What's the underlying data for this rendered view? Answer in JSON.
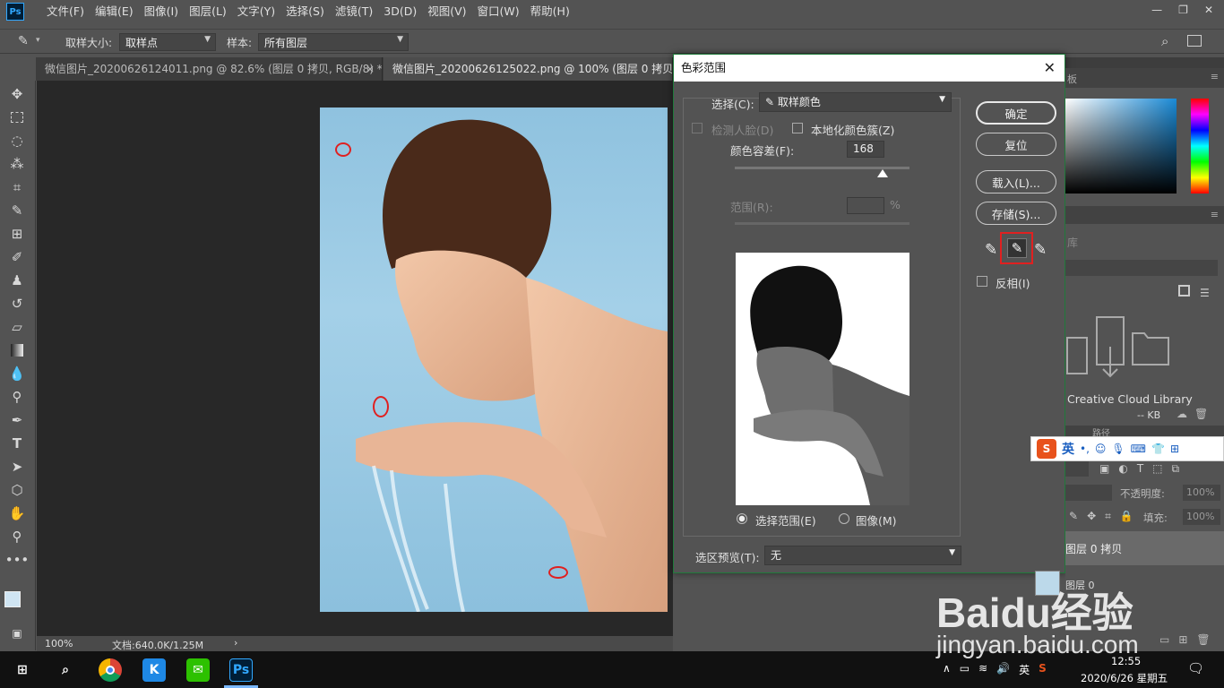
{
  "app": {
    "logo": "Ps"
  },
  "menu": [
    "文件(F)",
    "编辑(E)",
    "图像(I)",
    "图层(L)",
    "文字(Y)",
    "选择(S)",
    "滤镜(T)",
    "3D(D)",
    "视图(V)",
    "窗口(W)",
    "帮助(H)"
  ],
  "options": {
    "sample_size_label": "取样大小:",
    "sample_size_value": "取样点",
    "sample_label": "样本:",
    "sample_value": "所有图层"
  },
  "tabs": [
    {
      "label": "微信图片_20200626124011.png @ 82.6% (图层 0 拷贝, RGB/8) *",
      "close": "×"
    },
    {
      "label": "微信图片_20200626125022.png @ 100% (图层 0 拷贝, RGB"
    }
  ],
  "status": {
    "zoom": "100%",
    "doc": "文档:640.0K/1.25M",
    "arrow": "›"
  },
  "dialog": {
    "title": "色彩范围",
    "select_label": "选择(C):",
    "select_value": "取样颜色",
    "detect_faces": "检测人脸(D)",
    "localized": "本地化颜色簇(Z)",
    "fuzziness_label": "颜色容差(F):",
    "fuzziness_value": "168",
    "range_label": "范围(R):",
    "range_unit": "%",
    "radio_selection": "选择范围(E)",
    "radio_image": "图像(M)",
    "preview_label": "选区预览(T):",
    "preview_value": "无",
    "btn_ok": "确定",
    "btn_reset": "复位",
    "btn_load": "载入(L)...",
    "btn_save": "存储(S)...",
    "invert": "反相(I)"
  },
  "panels": {
    "color_tab": "板",
    "library_label": "库",
    "cc_library": "Creative Cloud Library",
    "kb": "-- KB",
    "paths_tab": "路径",
    "opacity_label": "不透明度:",
    "opacity_value": "100%",
    "fill_label": "填充:",
    "fill_value": "100%",
    "layers": [
      {
        "name": "图层 0 拷贝"
      },
      {
        "name": "图层 0"
      }
    ]
  },
  "ime": {
    "lang": "英"
  },
  "tray": {
    "time": "12:55",
    "date": "2020/6/26 星期五",
    "lang": "英"
  },
  "watermark": {
    "brand": "Baidu经验",
    "url": "jingyan.baidu.com"
  },
  "colors": {
    "accent_red": "#e02020",
    "ps_blue": "#31a8ff"
  }
}
